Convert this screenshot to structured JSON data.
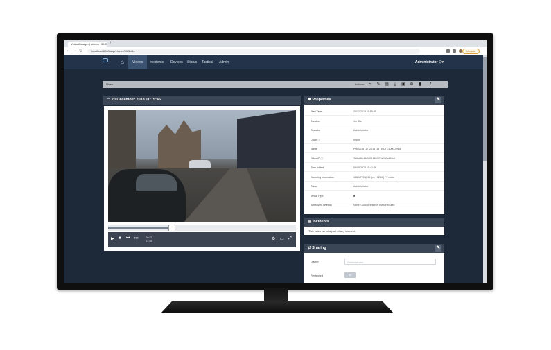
{
  "browser": {
    "tab_title": "VideoManager | videos | 3fb3 |",
    "new_tab_glyph": "+",
    "url": "localhost:8080/app/videos/3fb3cf1c",
    "update_label": "Update",
    "back_glyph": "←",
    "forward_glyph": "→",
    "reload_glyph": "↻"
  },
  "nav": {
    "home_glyph": "⌂",
    "items": [
      "Videos",
      "Incidents",
      "Devices",
      "Status",
      "Tactical",
      "Admin"
    ],
    "active_index": 0,
    "user_label": "Administrator ⚇▾"
  },
  "toolbar": {
    "breadcrumb": "Video",
    "actions_label": "Actions:",
    "action_glyphs": [
      "⇆",
      "✎",
      "▤",
      "⤓",
      "▣",
      "⊕",
      "▮",
      "↻"
    ]
  },
  "video": {
    "title": "20 December 2018 11:15:45",
    "title_glyph": "▭",
    "current_time": "00:21",
    "total_time": "01:40",
    "progress_fraction": 0.34,
    "control_glyphs": {
      "play": "▶",
      "stop": "■",
      "prev": "⏮",
      "next": "⏭",
      "settings": "⚙",
      "pip": "▭",
      "fullscreen": "⤢"
    }
  },
  "properties": {
    "title": "Properties",
    "title_glyph": "❖",
    "edit_glyph": "✎",
    "rows": [
      {
        "key": "Start Time",
        "value": "20/12/2018 11:15:45"
      },
      {
        "key": "Duration",
        "value": "1m 40s"
      },
      {
        "key": "Operator",
        "value": "Administrator"
      },
      {
        "key": "Origin ⓘ",
        "value": "Import"
      },
      {
        "key": "Name",
        "value": "POL0036_12_2018_15_49UTC10000.mp4"
      },
      {
        "key": "Video ID ⓘ",
        "value": "3b9a0f6c8f40d0168f437bb4d0a6f4a9"
      },
      {
        "key": "Time Added",
        "value": "06/09/2023 15:41:38"
      },
      {
        "key": "Encoding Information",
        "value": "1280x720 @30 fps, H.264 | YV u-law"
      },
      {
        "key": "Owner",
        "value": "Administrator"
      },
      {
        "key": "Media Type",
        "value": "■"
      },
      {
        "key": "Scheduled deletion",
        "value": "None / Auto deletion is not scheduled"
      }
    ]
  },
  "incidents": {
    "title": "Incidents",
    "title_glyph": "▤",
    "message": "This video is not a part of any incident."
  },
  "sharing": {
    "title": "Sharing",
    "title_glyph": "⇄",
    "edit_glyph": "✎",
    "owner_label": "Owner",
    "owner_value": "Administrator",
    "restricted_label": "Restricted",
    "restricted_value": "No"
  },
  "colors": {
    "nav_bg": "#23344a",
    "page_bg": "#1d2939",
    "panel_head": "#3a4656"
  }
}
